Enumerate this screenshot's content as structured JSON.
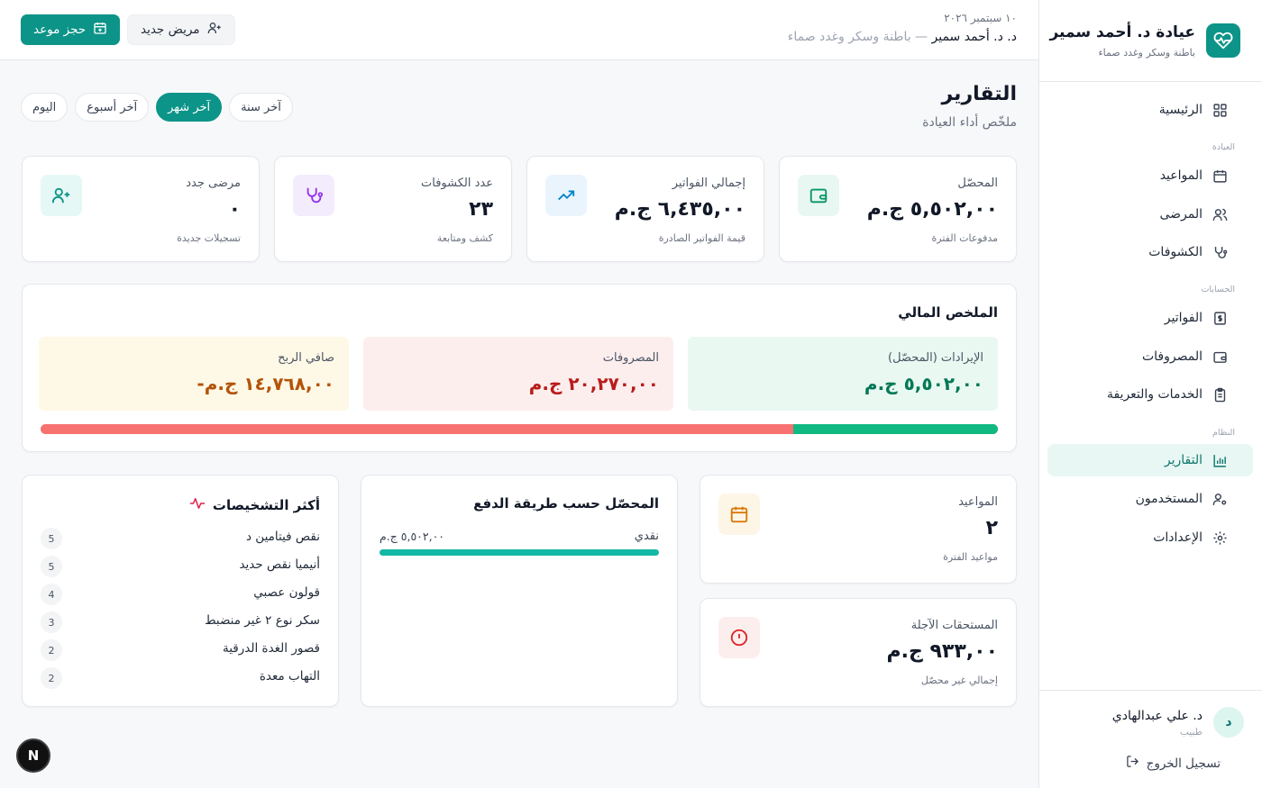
{
  "sidebar": {
    "brand_title": "عيادة د. أحمد سمير",
    "brand_subtitle": "باطنة وسكر وغدد صماء",
    "home": "الرئيسية",
    "section_clinic": "العيادة",
    "appointments": "المواعيد",
    "patients": "المرضى",
    "visits": "الكشوفات",
    "section_accounts": "الحسابات",
    "invoices": "الفواتير",
    "expenses": "المصروفات",
    "services": "الخدمات والتعريفة",
    "section_system": "النظام",
    "reports": "التقارير",
    "users": "المستخدمون",
    "settings": "الإعدادات",
    "user_initial": "د",
    "user_name": "د. علي عبدالهادي",
    "user_role": "طبيب",
    "logout": "تسجيل الخروج"
  },
  "topbar": {
    "date": "١٠ سبتمبر ٢٠٢٦",
    "doctor_name": "د. د. أحمد سمير",
    "specialty": " — باطنة وسكر وغدد صماء",
    "book_button": "حجز موعد",
    "new_patient_button": "مريض جديد"
  },
  "page": {
    "title": "التقارير",
    "subtitle": "ملخّص أداء العيادة",
    "periods": [
      "اليوم",
      "آخر أسبوع",
      "آخر شهر",
      "آخر سنة"
    ],
    "active_period": "آخر شهر"
  },
  "kpis": {
    "collected": {
      "label": "المحصّل",
      "value": "٥,٥٠٢,٠٠ ج.م",
      "note": "مدفوعات الفترة"
    },
    "invoiced": {
      "label": "إجمالي الفواتير",
      "value": "٦,٤٣٥,٠٠ ج.م",
      "note": "قيمة الفواتير الصادرة"
    },
    "visits": {
      "label": "عدد الكشوفات",
      "value": "٢٣",
      "note": "كشف ومتابعة"
    },
    "new_patients": {
      "label": "مرضى جدد",
      "value": "٠",
      "note": "تسجيلات جديدة"
    }
  },
  "financial": {
    "title": "الملخص المالي",
    "revenue_label": "الإيرادات (المحصّل)",
    "revenue_value": "٥,٥٠٢,٠٠ ج.م",
    "expenses_label": "المصروفات",
    "expenses_value": "٢٠,٢٧٠,٠٠ ج.م",
    "profit_label": "صافي الربح",
    "profit_value": "-١٤,٧٦٨,٠٠ ج.م",
    "revenue_share": 0.2135,
    "colors": {
      "revenue": "#10b981",
      "expenses": "#f87171",
      "profit": "#b45309"
    }
  },
  "appointments_card": {
    "label": "المواعيد",
    "value": "٢",
    "note": "مواعيد الفترة"
  },
  "receivables_card": {
    "label": "المستحقات الآجلة",
    "value": "٩٣٣,٠٠ ج.م",
    "note": "إجمالي غير محصّل"
  },
  "payments": {
    "title": "المحصّل حسب طريقة الدفع",
    "rows": [
      {
        "method": "نقدي",
        "amount": "٥,٥٠٢,٠٠ ج.م",
        "share": 1.0
      }
    ]
  },
  "diagnoses": {
    "title": "أكثر التشخيصات",
    "items": [
      {
        "name": "نقص فيتامين د",
        "count": "5"
      },
      {
        "name": "أنيميا نقص حديد",
        "count": "5"
      },
      {
        "name": "قولون عصبي",
        "count": "4"
      },
      {
        "name": "سكر نوع ٢ غير منضبط",
        "count": "3"
      },
      {
        "name": "قصور الغدة الدرقية",
        "count": "2"
      },
      {
        "name": "التهاب معدة",
        "count": "2"
      }
    ]
  },
  "fab_label": "N"
}
